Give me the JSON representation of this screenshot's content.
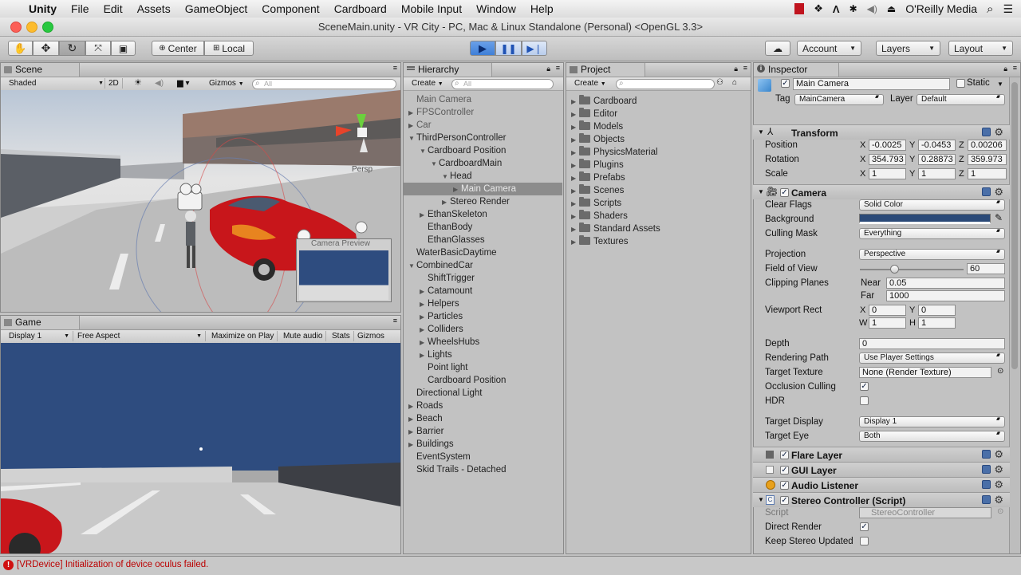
{
  "menubar": {
    "app": "Unity",
    "items": [
      "File",
      "Edit",
      "Assets",
      "GameObject",
      "Component",
      "Cardboard",
      "Mobile Input",
      "Window",
      "Help"
    ],
    "user": "O'Reilly Media"
  },
  "window_title": "SceneMain.unity - VR City - PC, Mac & Linux Standalone (Personal) <OpenGL 3.3>",
  "toolbar": {
    "pivot": "Center",
    "space": "Local",
    "account": "Account",
    "layers": "Layers",
    "layout": "Layout"
  },
  "scene": {
    "tab": "Scene",
    "shading": "Shaded",
    "mode_2d": "2D",
    "gizmos": "Gizmos",
    "search_placeholder": "All",
    "persp": "Persp",
    "camera_preview": "Camera Preview"
  },
  "game": {
    "tab": "Game",
    "display": "Display 1",
    "aspect": "Free Aspect",
    "buttons": [
      "Maximize on Play",
      "Mute audio",
      "Stats",
      "Gizmos"
    ]
  },
  "hierarchy": {
    "tab": "Hierarchy",
    "create": "Create",
    "search_placeholder": "All",
    "rows": [
      {
        "label": "Main Camera",
        "indent": 0,
        "arrow": "",
        "gray": true
      },
      {
        "label": "FPSController",
        "indent": 0,
        "arrow": "▶",
        "gray": true
      },
      {
        "label": "Car",
        "indent": 0,
        "arrow": "▶",
        "gray": true
      },
      {
        "label": "ThirdPersonController",
        "indent": 0,
        "arrow": "▼",
        "gray": false
      },
      {
        "label": "Cardboard Position",
        "indent": 1,
        "arrow": "▼",
        "gray": false
      },
      {
        "label": "CardboardMain",
        "indent": 2,
        "arrow": "▼",
        "gray": false
      },
      {
        "label": "Head",
        "indent": 3,
        "arrow": "▼",
        "gray": false
      },
      {
        "label": "Main Camera",
        "indent": 4,
        "arrow": "▶",
        "gray": false,
        "selected": true
      },
      {
        "label": "Stereo Render",
        "indent": 3,
        "arrow": "▶",
        "gray": false
      },
      {
        "label": "EthanSkeleton",
        "indent": 1,
        "arrow": "▶",
        "gray": false
      },
      {
        "label": "EthanBody",
        "indent": 1,
        "arrow": "",
        "gray": false
      },
      {
        "label": "EthanGlasses",
        "indent": 1,
        "arrow": "",
        "gray": false
      },
      {
        "label": "WaterBasicDaytime",
        "indent": 0,
        "arrow": "",
        "gray": false
      },
      {
        "label": "CombinedCar",
        "indent": 0,
        "arrow": "▼",
        "gray": false
      },
      {
        "label": "ShiftTrigger",
        "indent": 1,
        "arrow": "",
        "gray": false
      },
      {
        "label": "Catamount",
        "indent": 1,
        "arrow": "▶",
        "gray": false
      },
      {
        "label": "Helpers",
        "indent": 1,
        "arrow": "▶",
        "gray": false
      },
      {
        "label": "Particles",
        "indent": 1,
        "arrow": "▶",
        "gray": false
      },
      {
        "label": "Colliders",
        "indent": 1,
        "arrow": "▶",
        "gray": false
      },
      {
        "label": "WheelsHubs",
        "indent": 1,
        "arrow": "▶",
        "gray": false
      },
      {
        "label": "Lights",
        "indent": 1,
        "arrow": "▶",
        "gray": false
      },
      {
        "label": "Point light",
        "indent": 1,
        "arrow": "",
        "gray": false
      },
      {
        "label": "Cardboard Position",
        "indent": 1,
        "arrow": "",
        "gray": false
      },
      {
        "label": "Directional Light",
        "indent": 0,
        "arrow": "",
        "gray": false
      },
      {
        "label": "Roads",
        "indent": 0,
        "arrow": "▶",
        "gray": false
      },
      {
        "label": "Beach",
        "indent": 0,
        "arrow": "▶",
        "gray": false
      },
      {
        "label": "Barrier",
        "indent": 0,
        "arrow": "▶",
        "gray": false
      },
      {
        "label": "Buildings",
        "indent": 0,
        "arrow": "▶",
        "gray": false
      },
      {
        "label": "EventSystem",
        "indent": 0,
        "arrow": "",
        "gray": false
      },
      {
        "label": "Skid Trails - Detached",
        "indent": 0,
        "arrow": "",
        "gray": false
      }
    ]
  },
  "project": {
    "tab": "Project",
    "create": "Create",
    "folders": [
      "Cardboard",
      "Editor",
      "Models",
      "Objects",
      "PhysicsMaterial",
      "Plugins",
      "Prefabs",
      "Scenes",
      "Scripts",
      "Shaders",
      "Standard Assets",
      "Textures"
    ]
  },
  "inspector": {
    "tab": "Inspector",
    "object_name": "Main Camera",
    "static_label": "Static",
    "tag_label": "Tag",
    "tag_value": "MainCamera",
    "layer_label": "Layer",
    "layer_value": "Default",
    "transform": {
      "title": "Transform",
      "position_label": "Position",
      "rotation_label": "Rotation",
      "scale_label": "Scale",
      "position": [
        "-0.0025",
        "-0.0453",
        "0.00206"
      ],
      "rotation": [
        "354.793",
        "0.28873",
        "359.973"
      ],
      "scale": [
        "1",
        "1",
        "1"
      ]
    },
    "camera": {
      "title": "Camera",
      "clear_flags_label": "Clear Flags",
      "clear_flags": "Solid Color",
      "background_label": "Background",
      "background_color": "#2b4a78",
      "culling_mask_label": "Culling Mask",
      "culling_mask": "Everything",
      "projection_label": "Projection",
      "projection": "Perspective",
      "fov_label": "Field of View",
      "fov": "60",
      "fov_fraction": 0.33,
      "clipping_label": "Clipping Planes",
      "near_label": "Near",
      "near": "0.05",
      "far_label": "Far",
      "far": "1000",
      "viewport_label": "Viewport Rect",
      "vx": "0",
      "vy": "0",
      "vw": "1",
      "vh": "1",
      "depth_label": "Depth",
      "depth": "0",
      "rendering_path_label": "Rendering Path",
      "rendering_path": "Use Player Settings",
      "target_texture_label": "Target Texture",
      "target_texture": "None (Render Texture)",
      "occlusion_label": "Occlusion Culling",
      "hdr_label": "HDR",
      "target_display_label": "Target Display",
      "target_display": "Display 1",
      "target_eye_label": "Target Eye",
      "target_eye": "Both"
    },
    "flare_layer": "Flare Layer",
    "gui_layer": "GUI Layer",
    "audio_listener": "Audio Listener",
    "stereo": {
      "title": "Stereo Controller (Script)",
      "script_label": "Script",
      "script_value": "StereoController",
      "direct_render_label": "Direct Render",
      "keep_stereo_label": "Keep Stereo Updated"
    }
  },
  "console": {
    "message": "[VRDevice] Initialization of device oculus failed."
  },
  "colors": {
    "sky_game": "#2e4c7f",
    "selection": "#8c8c8c",
    "error": "#d01010"
  }
}
